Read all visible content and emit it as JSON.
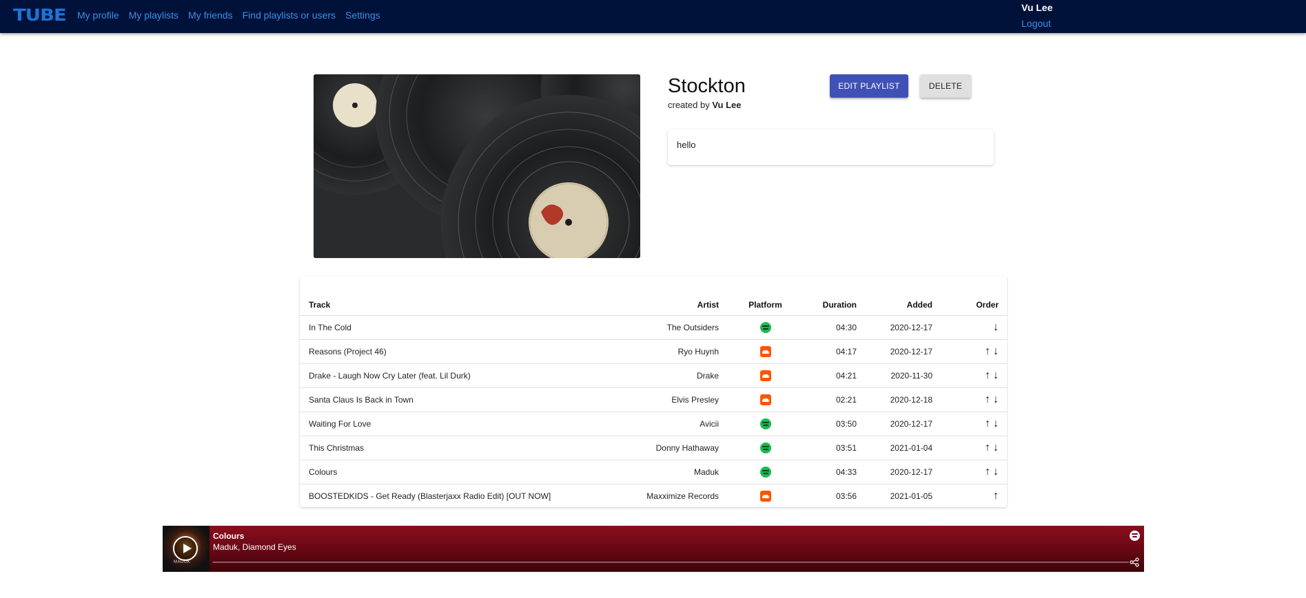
{
  "nav": {
    "logo": "TUBE",
    "links": [
      "My profile",
      "My playlists",
      "My friends",
      "Find playlists or users",
      "Settings"
    ],
    "user_name": "Vu Lee",
    "logout": "Logout"
  },
  "playlist": {
    "title": "Stockton",
    "created_by_prefix": "created by",
    "creator": "Vu Lee",
    "edit_label": "EDIT PLAYLIST",
    "delete_label": "DELETE",
    "description": "hello"
  },
  "table": {
    "headers": {
      "track": "Track",
      "artist": "Artist",
      "platform": "Platform",
      "duration": "Duration",
      "added": "Added",
      "order": "Order"
    },
    "rows": [
      {
        "track": "In The Cold",
        "artist": "The Outsiders",
        "platform": "spotify",
        "duration": "04:30",
        "added": "2020-12-17",
        "up": false,
        "down": true
      },
      {
        "track": "Reasons (Project 46)",
        "artist": "Ryo Huynh",
        "platform": "soundcloud",
        "duration": "04:17",
        "added": "2020-12-17",
        "up": true,
        "down": true
      },
      {
        "track": "Drake - Laugh Now Cry Later (feat. Lil Durk)",
        "artist": "Drake",
        "platform": "soundcloud",
        "duration": "04:21",
        "added": "2020-11-30",
        "up": true,
        "down": true
      },
      {
        "track": "Santa Claus Is Back in Town",
        "artist": "Elvis Presley",
        "platform": "soundcloud",
        "duration": "02:21",
        "added": "2020-12-18",
        "up": true,
        "down": true
      },
      {
        "track": "Waiting For Love",
        "artist": "Avicii",
        "platform": "spotify",
        "duration": "03:50",
        "added": "2020-12-17",
        "up": true,
        "down": true
      },
      {
        "track": "This Christmas",
        "artist": "Donny Hathaway",
        "platform": "spotify",
        "duration": "03:51",
        "added": "2021-01-04",
        "up": true,
        "down": true
      },
      {
        "track": "Colours",
        "artist": "Maduk",
        "platform": "spotify",
        "duration": "04:33",
        "added": "2020-12-17",
        "up": true,
        "down": true
      },
      {
        "track": "BOOSTEDKIDS - Get Ready (Blasterjaxx Radio Edit) [OUT NOW]",
        "artist": "Maxximize Records",
        "platform": "soundcloud",
        "duration": "03:56",
        "added": "2021-01-05",
        "up": true,
        "down": false
      }
    ]
  },
  "player": {
    "title": "Colours",
    "artists": "Maduk, Diamond Eyes",
    "album_text": "MADUK",
    "progress": 0
  },
  "colors": {
    "nav_bg": "#00123a",
    "link": "#3d8ee8",
    "primary_button": "#3f51b5",
    "spotify": "#1db954",
    "soundcloud": "#ff5500",
    "player_bg": "#6a0815"
  }
}
